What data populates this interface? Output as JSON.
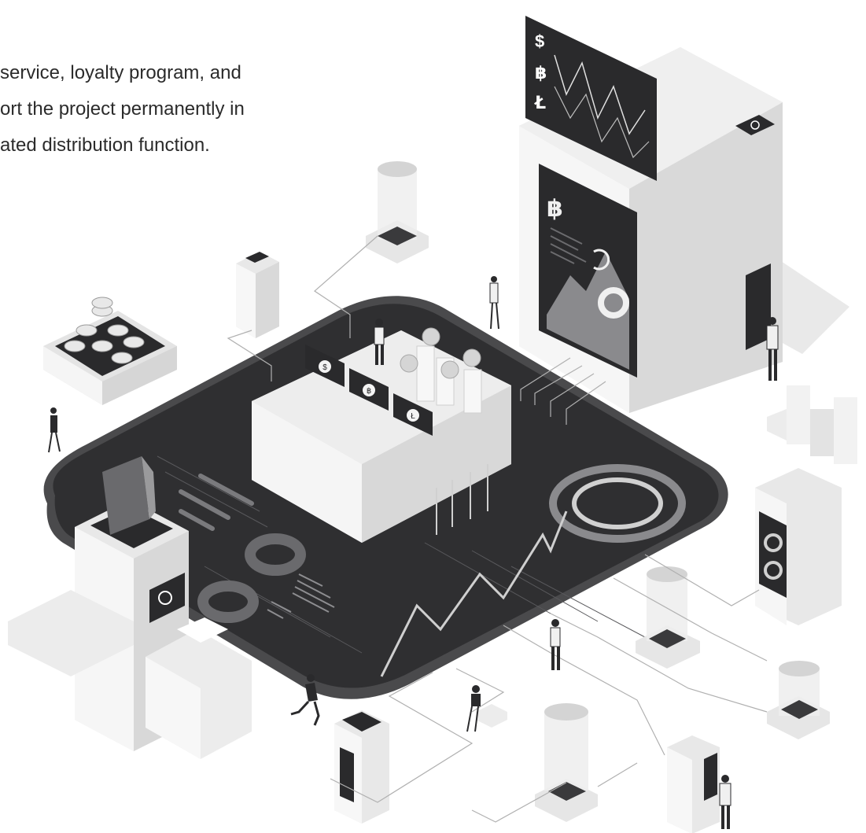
{
  "text_lines": [
    "service, loyalty program, and",
    "ort the project permanently in",
    "ated distribution function."
  ],
  "colors": {
    "board_dark": "#2f2f31",
    "board_edge": "#4a4a4c",
    "block_white": "#f4f4f4",
    "block_side": "#dcdcdc",
    "block_shade": "#c8c8c8",
    "ground_shadow": "#e6e6e6"
  },
  "icons": [
    "dollar-icon",
    "bitcoin-icon",
    "litecoin-icon",
    "refresh-icon"
  ]
}
